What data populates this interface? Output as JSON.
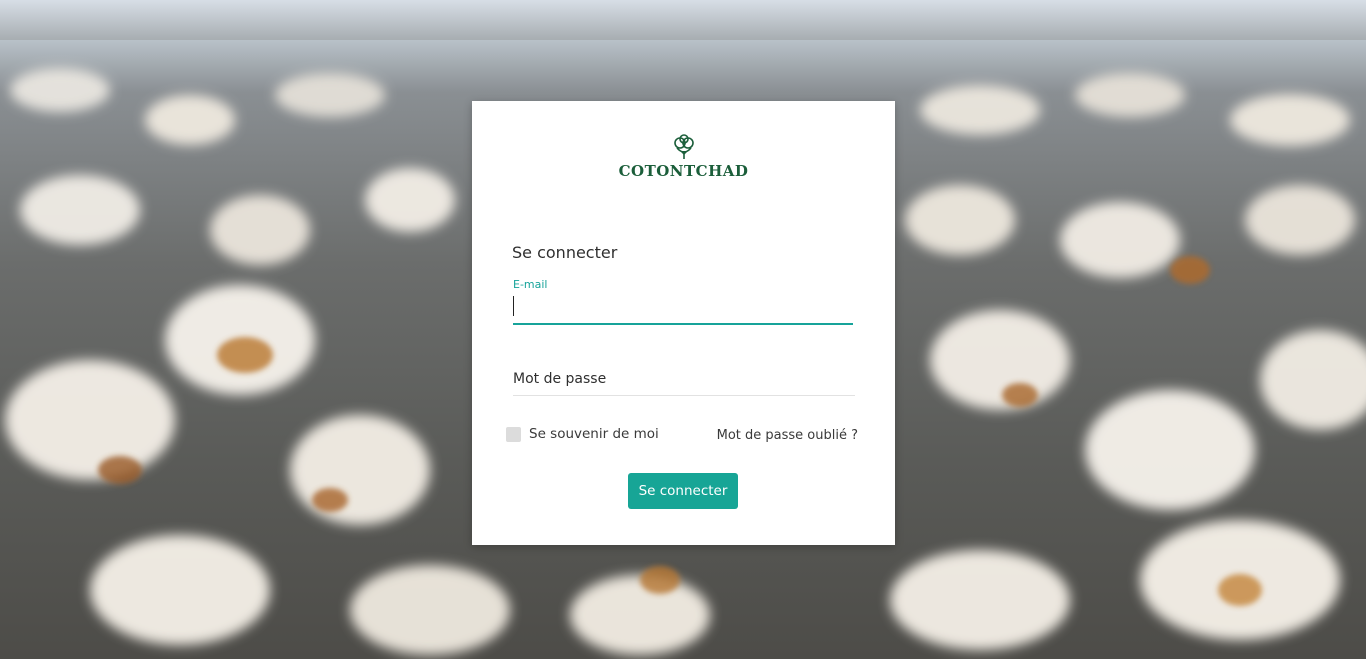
{
  "brand": {
    "name": "COTONTCHAD",
    "color": "#1b5e3a"
  },
  "login": {
    "title": "Se connecter",
    "email_label": "E-mail",
    "email_value": "",
    "password_placeholder": "Mot de passe",
    "remember_label": "Se souvenir de moi",
    "remember_checked": false,
    "forgot_label": "Mot de passe oublié ?",
    "submit_label": "Se connecter"
  },
  "colors": {
    "accent": "#17a596",
    "card_bg": "#ffffff"
  },
  "icons": {
    "logo": "cotton-boll-icon"
  }
}
